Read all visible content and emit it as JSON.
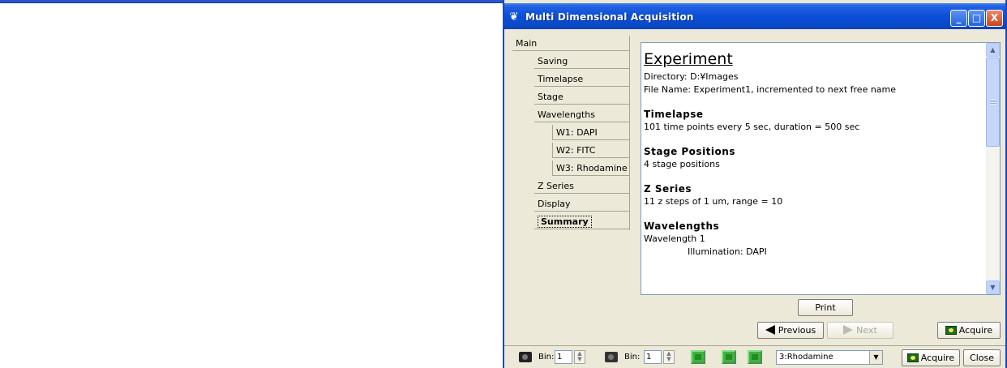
{
  "window": {
    "title": "Multi Dimensional Acquisition",
    "controls": {
      "minimize": "_",
      "maximize": "□",
      "close": "X"
    }
  },
  "tree": {
    "items": [
      {
        "label": "Main",
        "level": 0
      },
      {
        "label": "Saving",
        "level": 1
      },
      {
        "label": "Timelapse",
        "level": 1
      },
      {
        "label": "Stage",
        "level": 1
      },
      {
        "label": "Wavelengths",
        "level": 1
      },
      {
        "label": "W1: DAPI",
        "level": 2
      },
      {
        "label": "W2: FITC",
        "level": 2
      },
      {
        "label": "W3: Rhodamine",
        "level": 2
      },
      {
        "label": "Z Series",
        "level": 1
      },
      {
        "label": "Display",
        "level": 1
      },
      {
        "label": "Summary",
        "level": 1,
        "selected": true
      }
    ]
  },
  "summary": {
    "heading": "Experiment",
    "directory": "Directory: D:¥Images",
    "file_name": "File Name: Experiment1, incremented to next free name",
    "timelapse_title": "Timelapse",
    "timelapse_text": "101 time points every 5 sec, duration = 500 sec",
    "stage_title": "Stage Positions",
    "stage_text": "4 stage positions",
    "z_title": "Z Series",
    "z_text": "11 z steps of 1 um,  range = 10",
    "wavelengths_title": "Wavelengths",
    "wavelength_1": "Wavelength 1",
    "illumination": "Illumination: DAPI"
  },
  "buttons": {
    "print": "Print",
    "previous": "Previous",
    "next": "Next",
    "acquire": "Acquire",
    "acquire_bottom": "Acquire",
    "close": "Close"
  },
  "bottombar": {
    "bin_label_1": "Bin:",
    "bin_value_1": "1",
    "bin_label_2": "Bin:",
    "bin_value_2": "1",
    "wavelength_selected": "3:Rhodamine"
  },
  "icons": {
    "app": "butterfly-icon",
    "camera": "camera-icon",
    "play": "play-icon"
  }
}
